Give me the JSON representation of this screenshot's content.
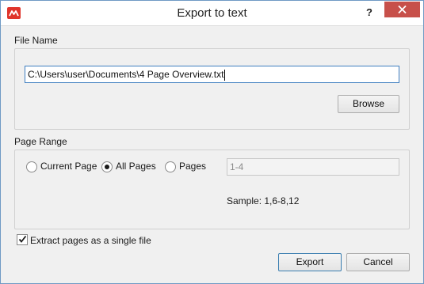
{
  "window": {
    "title": "Export to text",
    "help_label": "?",
    "colors": {
      "close_button": "#c7504a",
      "app_icon": "#e0352b",
      "focus_border": "#3f7fc0"
    }
  },
  "file_name": {
    "label": "File Name",
    "value": "C:\\Users\\user\\Documents\\4 Page Overview.txt",
    "browse_label": "Browse"
  },
  "page_range": {
    "label": "Page Range",
    "options": [
      {
        "label": "Current Page",
        "selected": false
      },
      {
        "label": "All Pages",
        "selected": true
      },
      {
        "label": "Pages",
        "selected": false
      }
    ],
    "pages_value": "1-4",
    "sample_text": "Sample: 1,6-8,12"
  },
  "options": {
    "single_file_label": "Extract pages as a single file",
    "single_file_checked": true
  },
  "footer": {
    "export_label": "Export",
    "cancel_label": "Cancel"
  }
}
